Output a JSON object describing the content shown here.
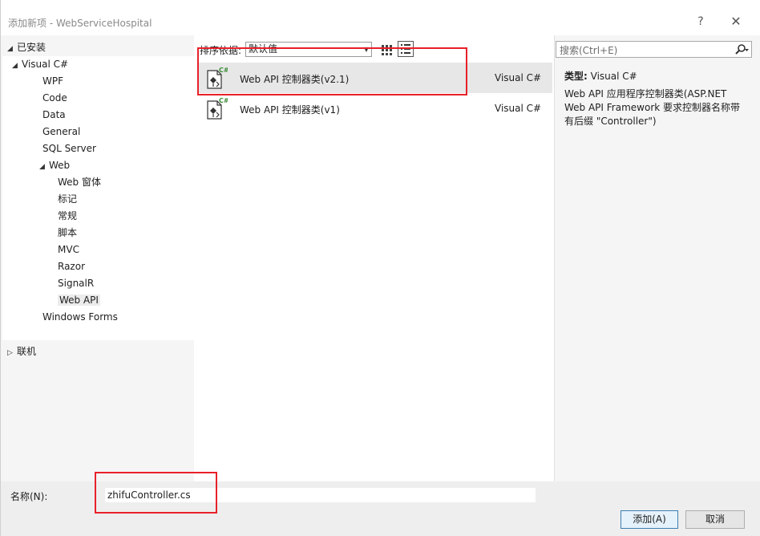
{
  "window": {
    "title": "添加新项 - WebServiceHospital",
    "help_glyph": "?",
    "close_glyph": "✕"
  },
  "left_panel": {
    "installed_label": "已安装",
    "tree": [
      {
        "label": "Visual C#",
        "level": 0,
        "arrow": "◢",
        "selected": false
      },
      {
        "label": "WPF",
        "level": 1,
        "arrow": "",
        "selected": false
      },
      {
        "label": "Code",
        "level": 1,
        "arrow": "",
        "selected": false
      },
      {
        "label": "Data",
        "level": 1,
        "arrow": "",
        "selected": false
      },
      {
        "label": "General",
        "level": 1,
        "arrow": "",
        "selected": false
      },
      {
        "label": "SQL Server",
        "level": 1,
        "arrow": "",
        "selected": false
      },
      {
        "label": "Web",
        "level": 1,
        "arrow": "◢",
        "selected": false
      },
      {
        "label": "Web 窗体",
        "level": 2,
        "arrow": "",
        "selected": false
      },
      {
        "label": "标记",
        "level": 2,
        "arrow": "",
        "selected": false
      },
      {
        "label": "常规",
        "level": 2,
        "arrow": "",
        "selected": false
      },
      {
        "label": "脚本",
        "level": 2,
        "arrow": "",
        "selected": false
      },
      {
        "label": "MVC",
        "level": 2,
        "arrow": "",
        "selected": false
      },
      {
        "label": "Razor",
        "level": 2,
        "arrow": "",
        "selected": false
      },
      {
        "label": "SignalR",
        "level": 2,
        "arrow": "",
        "selected": false
      },
      {
        "label": "Web API",
        "level": 2,
        "arrow": "",
        "selected": true
      },
      {
        "label": "Windows Forms",
        "level": 1,
        "arrow": "",
        "selected": false
      }
    ],
    "online_label": "联机"
  },
  "toolbar": {
    "sort_label": "排序依据:",
    "sort_value": "默认值"
  },
  "templates": [
    {
      "name": "Web API 控制器类(v2.1)",
      "language": "Visual C#",
      "selected": true
    },
    {
      "name": "Web API 控制器类(v1)",
      "language": "Visual C#",
      "selected": false
    }
  ],
  "details": {
    "search_placeholder": "搜索(Ctrl+E)",
    "type_label": "类型:",
    "type_value": "Visual C#",
    "description": "Web API 应用程序控制器类(ASP.NET Web API Framework 要求控制器名称带有后缀 \"Controller\")"
  },
  "footer": {
    "name_label": "名称(N):",
    "name_value": "zhifuController.cs",
    "add_button": "添加(A)",
    "cancel_button": "取消"
  },
  "colors": {
    "annotation_red": "#e8212a",
    "selection_gray": "#e7e7e7",
    "csharp_green": "#388a34"
  }
}
